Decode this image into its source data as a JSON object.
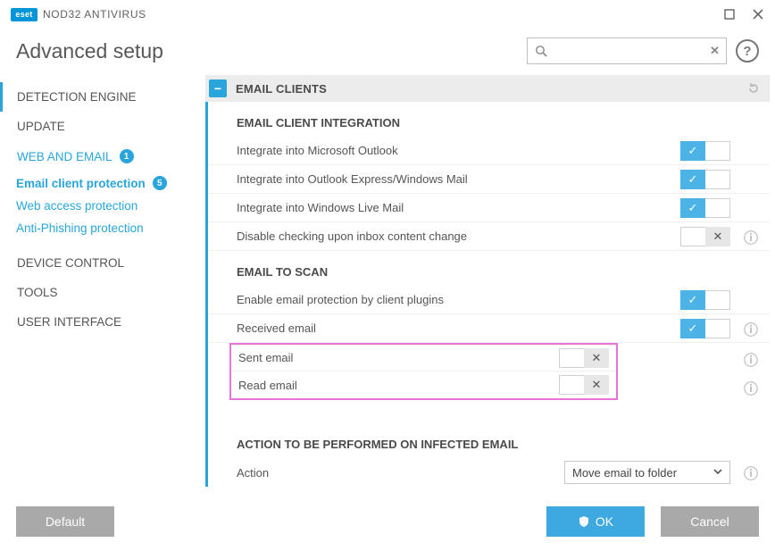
{
  "product": {
    "badge": "eset",
    "name": "NOD32 ANTIVIRUS"
  },
  "page_title": "Advanced setup",
  "search": {
    "value": "",
    "placeholder": ""
  },
  "sidebar": {
    "items": [
      {
        "label": "DETECTION ENGINE"
      },
      {
        "label": "UPDATE"
      },
      {
        "label": "WEB AND EMAIL",
        "badge": "1"
      },
      {
        "label": "DEVICE CONTROL"
      },
      {
        "label": "TOOLS"
      },
      {
        "label": "USER INTERFACE"
      }
    ],
    "subs": [
      {
        "label": "Email client protection",
        "badge": "5"
      },
      {
        "label": "Web access protection"
      },
      {
        "label": "Anti-Phishing protection"
      }
    ]
  },
  "panel": {
    "title": "EMAIL CLIENTS"
  },
  "sections": {
    "integration": {
      "title": "EMAIL CLIENT INTEGRATION",
      "rows": [
        {
          "label": "Integrate into Microsoft Outlook",
          "state": "on"
        },
        {
          "label": "Integrate into Outlook Express/Windows Mail",
          "state": "on"
        },
        {
          "label": "Integrate into Windows Live Mail",
          "state": "on"
        },
        {
          "label": "Disable checking upon inbox content change",
          "state": "off",
          "info": true
        }
      ]
    },
    "scan": {
      "title": "EMAIL TO SCAN",
      "rows": [
        {
          "label": "Enable email protection by client plugins",
          "state": "on"
        },
        {
          "label": "Received email",
          "state": "on",
          "info": true
        }
      ],
      "highlighted": [
        {
          "label": "Sent email",
          "state": "off",
          "info": true
        },
        {
          "label": "Read email",
          "state": "off",
          "info": true
        }
      ]
    },
    "action": {
      "title": "ACTION TO BE PERFORMED ON INFECTED EMAIL",
      "row_label": "Action",
      "selected": "Move email to folder"
    }
  },
  "buttons": {
    "default": "Default",
    "ok": "OK",
    "cancel": "Cancel"
  }
}
